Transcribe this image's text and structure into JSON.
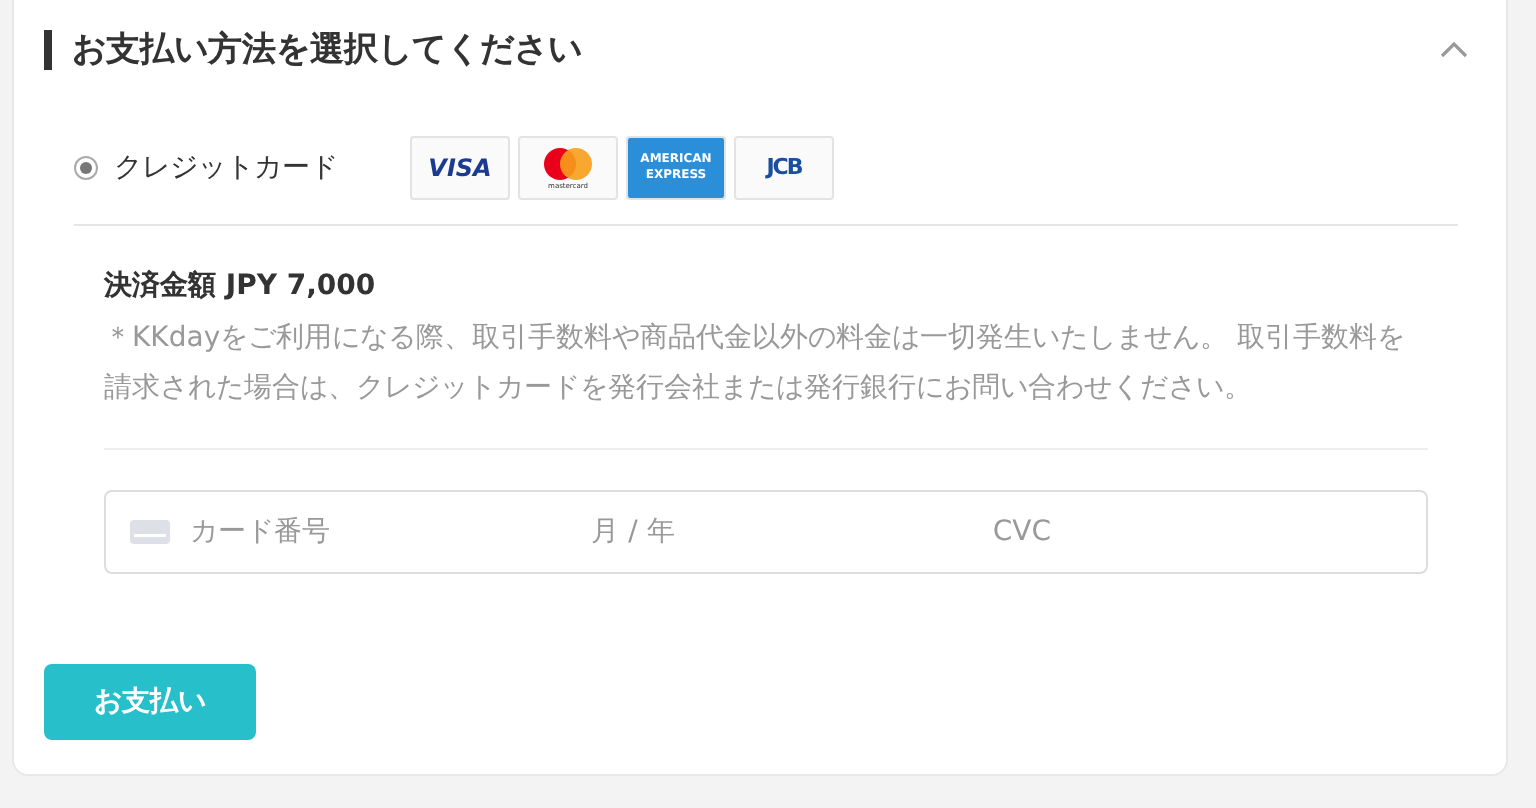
{
  "title": "お支払い方法を選択してください",
  "expanded": true,
  "methods": [
    {
      "label": "クレジットカード",
      "selected": true,
      "brands": [
        {
          "kind": "visa",
          "label": "VISA"
        },
        {
          "kind": "mastercard",
          "label": "mastercard"
        },
        {
          "kind": "amex",
          "label": "AMERICAN EXPRESS"
        },
        {
          "kind": "jcb",
          "label": "JCB"
        }
      ]
    }
  ],
  "amount": "決済金額 JPY 7,000",
  "note": "＊KKdayをご利用になる際、取引手数料や商品代金以外の料金は一切発生いたしません。 取引手数料を請求された場合は、クレジットカードを発行会社または発行銀行にお問い合わせください。",
  "card_field": {
    "placeholder": "カード番号",
    "expiry_placeholder": "月 / 年",
    "cvc_placeholder": "CVC"
  },
  "pay_button": "お支払い"
}
